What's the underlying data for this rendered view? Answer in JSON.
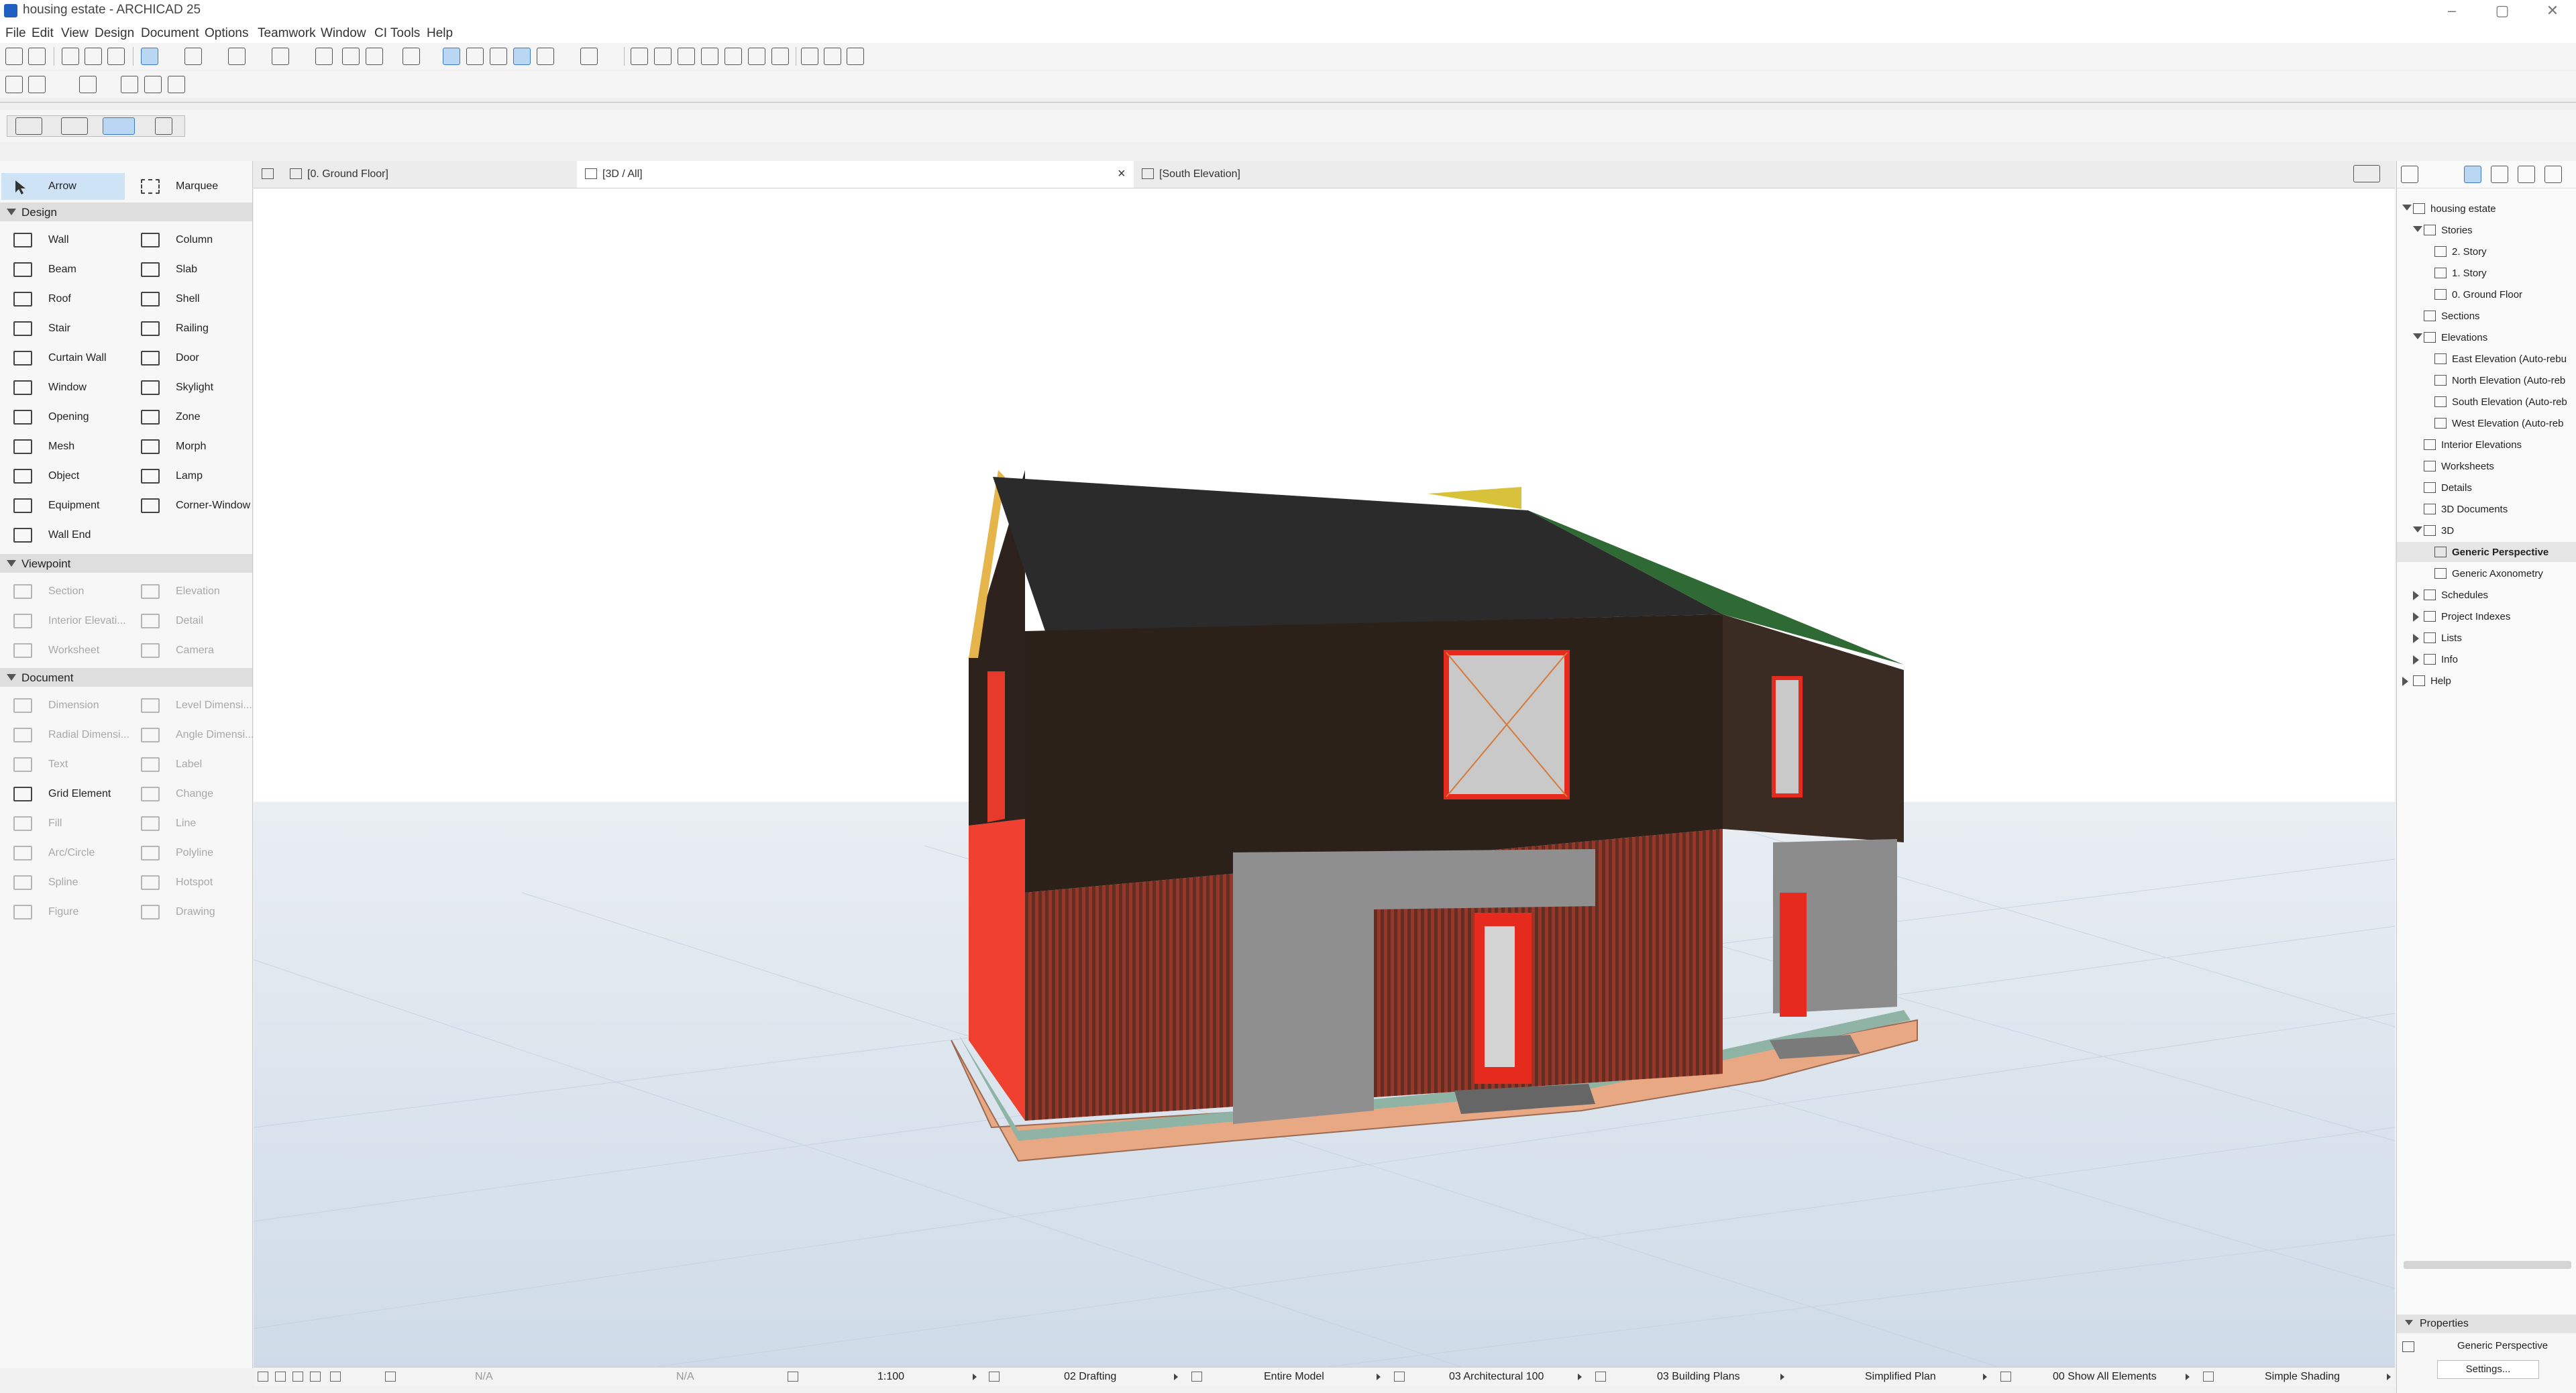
{
  "app": {
    "title": "housing estate - ARCHICAD 25"
  },
  "menu": [
    "File",
    "Edit",
    "View",
    "Design",
    "Document",
    "Options",
    "Teamwork",
    "Window",
    "CI Tools",
    "Help"
  ],
  "toolbox": {
    "arrow": "Arrow",
    "marquee": "Marquee",
    "sections": {
      "design": "Design",
      "viewpoint": "Viewpoint",
      "document": "Document"
    },
    "design_tools": [
      "Wall",
      "Column",
      "Beam",
      "Slab",
      "Roof",
      "Shell",
      "Stair",
      "Railing",
      "Curtain Wall",
      "Door",
      "Window",
      "Skylight",
      "Opening",
      "Zone",
      "Mesh",
      "Morph",
      "Object",
      "Lamp",
      "Equipment",
      "Corner-Window",
      "Wall End"
    ],
    "viewpoint_tools": [
      "Section",
      "Elevation",
      "Interior Elevati...",
      "Detail",
      "Worksheet",
      "Camera"
    ],
    "document_tools": [
      "Dimension",
      "Level Dimensi...",
      "Radial Dimensi...",
      "Angle Dimensi...",
      "Text",
      "Label",
      "Grid Element",
      "Change",
      "Fill",
      "Line",
      "Arc/Circle",
      "Polyline",
      "Spline",
      "Hotspot",
      "Figure",
      "Drawing"
    ]
  },
  "tabs": [
    {
      "label": "[0. Ground Floor]"
    },
    {
      "label": "[3D / All]",
      "close": "×"
    },
    {
      "label": "[South Elevation]"
    }
  ],
  "navigator": {
    "root": "housing estate",
    "stories": "Stories",
    "story_items": [
      "2. Story",
      "1. Story",
      "0. Ground Floor"
    ],
    "sections": "Sections",
    "elevations": "Elevations",
    "elevation_items": [
      "East Elevation (Auto-rebu",
      "North Elevation (Auto-reb",
      "South Elevation (Auto-reb",
      "West Elevation (Auto-reb"
    ],
    "interior_elevations": "Interior Elevations",
    "worksheets": "Worksheets",
    "details": "Details",
    "documents_3d": "3D Documents",
    "three_d": "3D",
    "three_d_items": [
      "Generic Perspective",
      "Generic Axonometry"
    ],
    "schedules": "Schedules",
    "project_indexes": "Project Indexes",
    "lists": "Lists",
    "info": "Info",
    "help": "Help"
  },
  "properties": {
    "header": "Properties",
    "view_name": "Generic Perspective",
    "settings": "Settings..."
  },
  "statusbar": {
    "na1": "N/A",
    "na2": "N/A",
    "scale": "1:100",
    "layer": "02 Drafting",
    "model": "Entire Model",
    "pen": "03 Architectural 100",
    "plan": "03 Building Plans",
    "plan_type": "Simplified Plan",
    "elements": "00 Show All Elements",
    "shading": "Simple Shading"
  },
  "colors": {
    "accent": "#3a78c3",
    "wall_dark": "#2c2119",
    "wall_red": "#e8392c",
    "cladding_grey": "#8f8f8f",
    "roof": "#2b2b2b",
    "roof_green": "#2f6a35"
  }
}
